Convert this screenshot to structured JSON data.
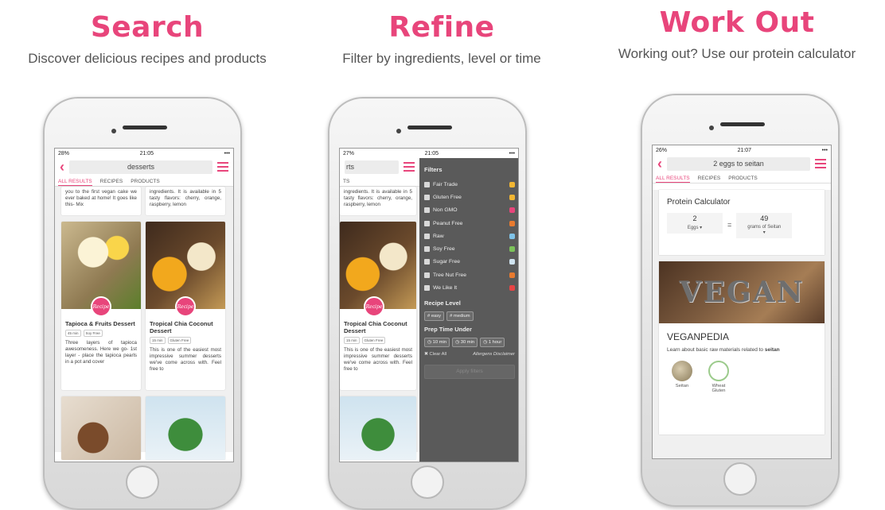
{
  "colors": {
    "accent": "#e8457b",
    "filter_panel": "#5a5a5a"
  },
  "panels": [
    {
      "heading": "Search",
      "subtitle": "Discover delicious recipes and products"
    },
    {
      "heading": "Refine",
      "subtitle": "Filter by ingredients, level or time"
    },
    {
      "heading": "Work Out",
      "subtitle": "Working out? Use our protein calculator"
    }
  ],
  "phone1": {
    "status": {
      "battery": "28%",
      "time": "21:05"
    },
    "search_value": "desserts",
    "tabs": [
      "ALL RESULTS",
      "RECIPES",
      "PRODUCTS"
    ],
    "top_cards": [
      "you to the first vegan cake we ever baked at home! It goes like this- Mix",
      "ingredients. It is available in 5 tasty flavors: cherry, orange, raspberry, lemon"
    ],
    "badge": "Recipe",
    "cards": [
      {
        "title": "Tapioca & Fruits Dessert",
        "tags": [
          "45 min",
          "Soy Free"
        ],
        "text": "Three layers of tapioca awesomeness. Here we go- 1st layer - place the tapioca pearls in a pot and cover"
      },
      {
        "title": "Tropical Chia Coconut Dessert",
        "tags": [
          "15 min",
          "Gluten Free"
        ],
        "text": "This is one of the easiest most impressive summer desserts we've come across with. Feel free to"
      }
    ]
  },
  "phone2": {
    "status": {
      "battery": "27%",
      "time": "21:05"
    },
    "search_value": "rts",
    "tab_fragment": "TS",
    "bg_top_text": "ingredients. It is available in 5 tasty flavors: cherry, orange, raspberry, lemon",
    "bg_card": {
      "title": "Tropical Chia Coconut Dessert",
      "tags": [
        "15 min",
        "Gluten Free"
      ],
      "text": "This is one of the easiest most impressive summer desserts we've come across with. Feel free to"
    },
    "badge": "Recipe",
    "filters_heading": "Filters",
    "filters": [
      "Fair Trade",
      "Gluten Free",
      "Non GMO",
      "Peanut Free",
      "Raw",
      "Soy Free",
      "Sugar Free",
      "Tree Nut Free",
      "We Like It"
    ],
    "filter_icon_colors": [
      "#f2b632",
      "#f2b632",
      "#e8457b",
      "#e97b2f",
      "#7fc3e8",
      "#7cc35a",
      "#cfe3ef",
      "#e97b2f",
      "#e84545"
    ],
    "level_heading": "Recipe Level",
    "levels": [
      "# easy",
      "# medium"
    ],
    "time_heading": "Prep Time Under",
    "times": [
      "10 min",
      "30 min",
      "1 hour"
    ],
    "clear_all": "Clear All",
    "disclaimer": "Allergens Disclaimer",
    "apply_label": "Apply filters"
  },
  "phone3": {
    "status": {
      "battery": "26%",
      "time": "21:07"
    },
    "search_value": "2 eggs to seitan",
    "tabs": [
      "ALL RESULTS",
      "RECIPES",
      "PRODUCTS"
    ],
    "calc": {
      "title": "Protein Calculator",
      "left_value": "2",
      "left_unit": "Eggs ▾",
      "equals": "=",
      "right_value": "49",
      "right_unit": "grams of Seitan",
      "right_caret": "▾"
    },
    "vegan_image_word": "VEGAN",
    "vegan_title": "VEGANPEDIA",
    "vegan_desc_prefix": "Learn about basic raw materials related to",
    "vegan_desc_bold": "seitan",
    "materials": [
      "Seitan",
      "Wheat Gluten"
    ]
  }
}
